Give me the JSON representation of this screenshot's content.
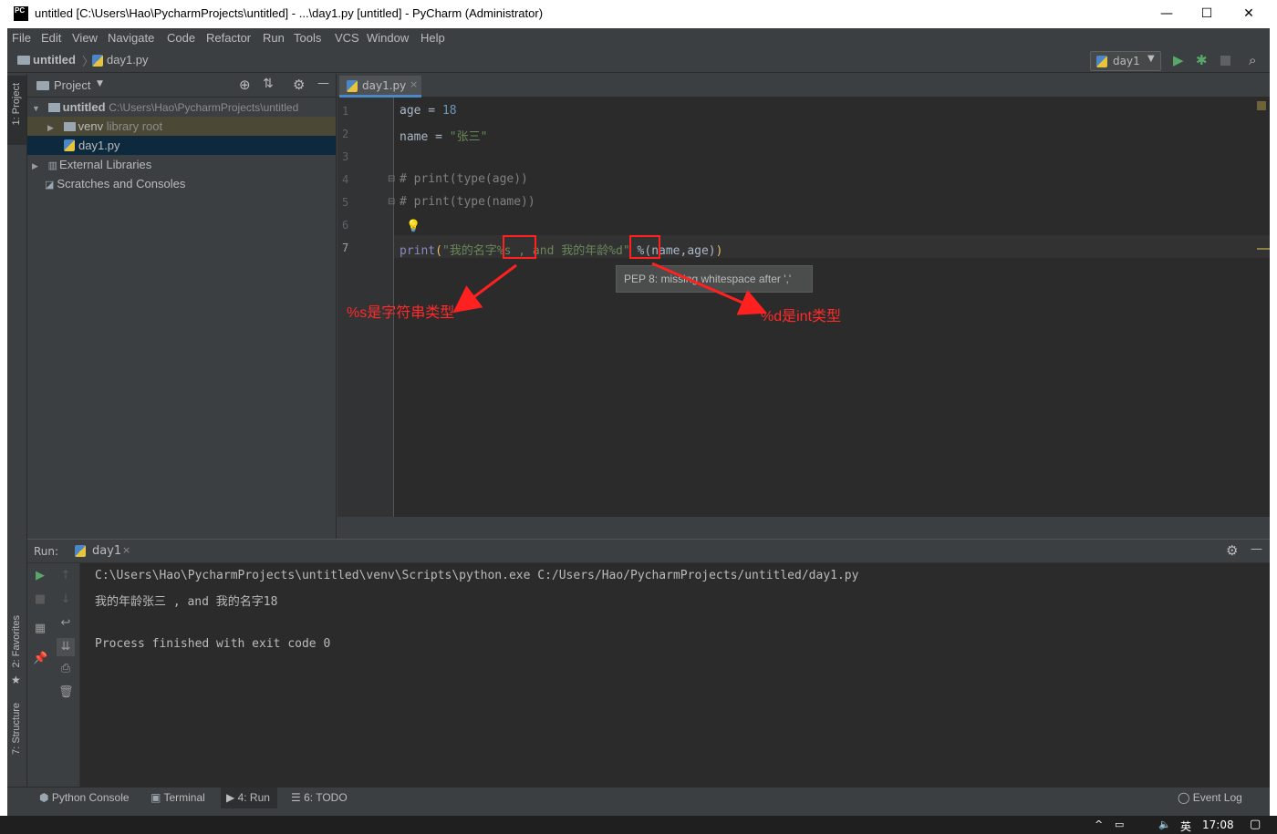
{
  "window": {
    "title": "untitled [C:\\Users\\Hao\\PycharmProjects\\untitled] - ...\\day1.py [untitled] - PyCharm (Administrator)",
    "logo": "PC",
    "minimize": "—",
    "maximize": "☐",
    "close": "✕"
  },
  "menu": [
    "File",
    "Edit",
    "View",
    "Navigate",
    "Code",
    "Refactor",
    "Run",
    "Tools",
    "VCS",
    "Window",
    "Help"
  ],
  "breadcrumb": {
    "project": "untitled",
    "file": "day1.py"
  },
  "run_config": {
    "name": "day1"
  },
  "left_stripe": {
    "project": "1: Project",
    "favorites": "2: Favorites",
    "structure": "7: Structure"
  },
  "project_panel": {
    "title": "Project",
    "tree": {
      "root": {
        "name": "untitled",
        "path": "C:\\Users\\Hao\\PycharmProjects\\untitled"
      },
      "venv": {
        "name": "venv",
        "note": "library root"
      },
      "file": "day1.py",
      "ext_libs": "External Libraries",
      "scratches": "Scratches and Consoles"
    }
  },
  "editor": {
    "tab": "day1.py",
    "line_numbers": [
      "1",
      "2",
      "3",
      "4",
      "5",
      "6",
      "7"
    ],
    "code": {
      "l1_var": "age",
      "l1_op": " = ",
      "l1_val": "18",
      "l2_var": "name",
      "l2_op": " = ",
      "l2_val": "\"张三\"",
      "l4": "# print(type(age))",
      "l5": "# print(type(name))",
      "l7_fn": "print",
      "l7_paren_open": "(",
      "l7_str": "\"我的名字%s , and 我的年龄%d\"",
      "l7_rest": " %(name,age)",
      "l7_paren_close": ")"
    },
    "tooltip": "PEP 8: missing whitespace after ','",
    "annotations": {
      "s_note": "%s是字符串类型",
      "d_note": "%d是int类型"
    }
  },
  "run_panel": {
    "label": "Run:",
    "tab": "day1",
    "output": [
      "C:\\Users\\Hao\\PycharmProjects\\untitled\\venv\\Scripts\\python.exe C:/Users/Hao/PycharmProjects/untitled/day1.py",
      "我的年龄张三 , and 我的名字18",
      "",
      "Process finished with exit code 0"
    ]
  },
  "bottom_tabs": [
    "Python Console",
    "Terminal",
    "4: Run",
    "6: TODO"
  ],
  "event_log": "Event Log",
  "taskbar": {
    "lang": "英",
    "time": "17:08"
  },
  "colors": {
    "accent": "#4a88c7",
    "annotation": "#ff2020",
    "editor_bg": "#2b2b2b",
    "panel_bg": "#3c3f41"
  }
}
